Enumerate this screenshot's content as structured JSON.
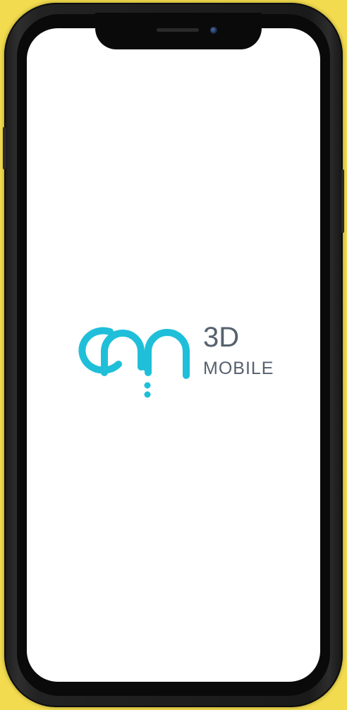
{
  "device": {
    "type": "phone",
    "background_color": "#f2db4e",
    "frame_color": "#1a1a1a",
    "screen_color": "#ffffff"
  },
  "splash": {
    "logo_icon": "om-logo-icon",
    "logo_color": "#1fbfd9",
    "title_line1": "3D",
    "title_line2": "MOBILE",
    "text_color": "#56616e"
  }
}
